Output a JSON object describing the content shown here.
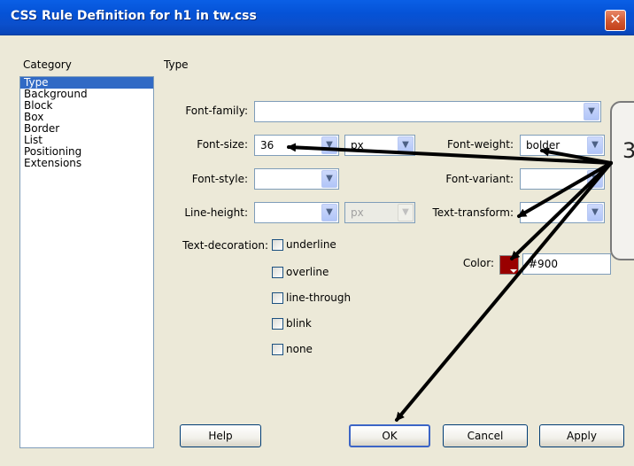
{
  "window": {
    "title": "CSS Rule Definition for h1 in tw.css",
    "close_glyph": "✕"
  },
  "headers": {
    "category": "Category",
    "type": "Type"
  },
  "categories": [
    "Type",
    "Background",
    "Block",
    "Box",
    "Border",
    "List",
    "Positioning",
    "Extensions"
  ],
  "selected_category": "Type",
  "fields": {
    "font_family": {
      "label": "Font-family:",
      "value": ""
    },
    "font_size": {
      "label": "Font-size:",
      "value": "36",
      "unit": "px"
    },
    "font_weight": {
      "label": "Font-weight:",
      "value": "bolder"
    },
    "font_style": {
      "label": "Font-style:",
      "value": ""
    },
    "font_variant": {
      "label": "Font-variant:",
      "value": ""
    },
    "line_height": {
      "label": "Line-height:",
      "value": "",
      "unit": "px"
    },
    "text_transform": {
      "label": "Text-transform:",
      "value": ""
    },
    "color": {
      "label": "Color:",
      "value": "#900",
      "swatch": "#990000"
    }
  },
  "text_decoration": {
    "label": "Text-decoration:",
    "options": [
      "underline",
      "overline",
      "line-through",
      "blink",
      "none"
    ]
  },
  "buttons": {
    "help": "Help",
    "ok": "OK",
    "cancel": "Cancel",
    "apply": "Apply"
  },
  "callout": {
    "number": "3"
  },
  "icons": {
    "dropdown": "chevron-down-icon",
    "close": "close-icon"
  },
  "colors": {
    "title_bar": "#0552d6",
    "selection": "#316ac5",
    "dialog_bg": "#ece9d8"
  }
}
